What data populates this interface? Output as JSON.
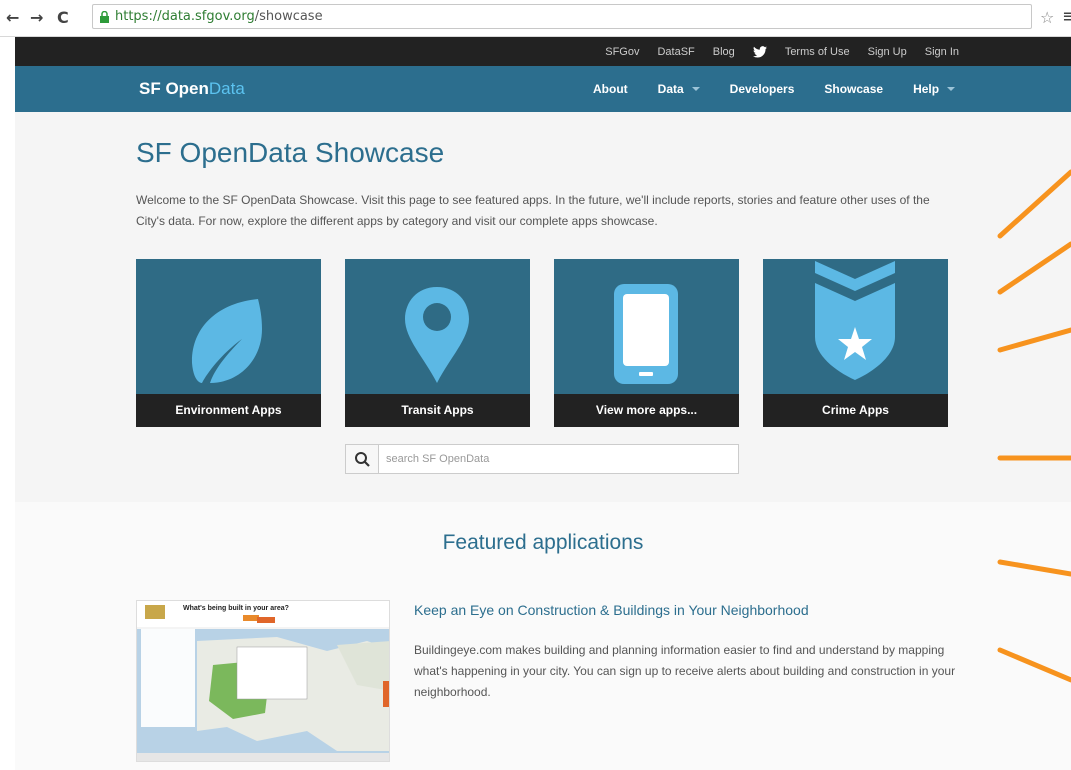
{
  "browser": {
    "back": "←",
    "forward": "→",
    "reload": "C",
    "url_host": "https://data.sfgov.org",
    "url_path": "/showcase",
    "star": "☆",
    "menu": "≡"
  },
  "utility_nav": {
    "links": [
      "SFGov",
      "DataSF",
      "Blog",
      "Terms of Use",
      "Sign Up",
      "Sign In"
    ]
  },
  "main_nav": {
    "brand_a": "SF Open",
    "brand_b": "Data",
    "items": [
      "About",
      "Data",
      "Developers",
      "Showcase",
      "Help"
    ]
  },
  "hero": {
    "title": "SF OpenData Showcase",
    "intro": "Welcome to the SF OpenData Showcase. Visit this page to see featured apps. In the future, we'll include reports, stories and feature other uses of the City's data. For now, explore the different apps by category and visit our complete apps showcase.",
    "tiles": [
      {
        "label": "Environment Apps",
        "icon": "leaf-icon"
      },
      {
        "label": "Transit Apps",
        "icon": "map-pin-icon"
      },
      {
        "label": "View more apps...",
        "icon": "smartphone-icon"
      },
      {
        "label": "Crime Apps",
        "icon": "police-badge-icon"
      }
    ],
    "search_placeholder": "search SF OpenData"
  },
  "featured": {
    "title": "Featured applications",
    "app": {
      "title": "Keep an Eye on Construction & Buildings in Your Neighborhood",
      "description": "Buildingeye.com makes building and planning information easier to find and understand by mapping what's happening in your city. You can sign up to receive alerts about building and construction in your neighborhood.",
      "thumb_heading": "What's being built in your area?"
    }
  },
  "colors": {
    "nav_blue": "#2c6e8e",
    "tile_blue": "#2f6b85",
    "icon_blue": "#5cb8e4",
    "accent_cyan": "#5cc3f0",
    "annotation_orange": "#f7931e"
  }
}
